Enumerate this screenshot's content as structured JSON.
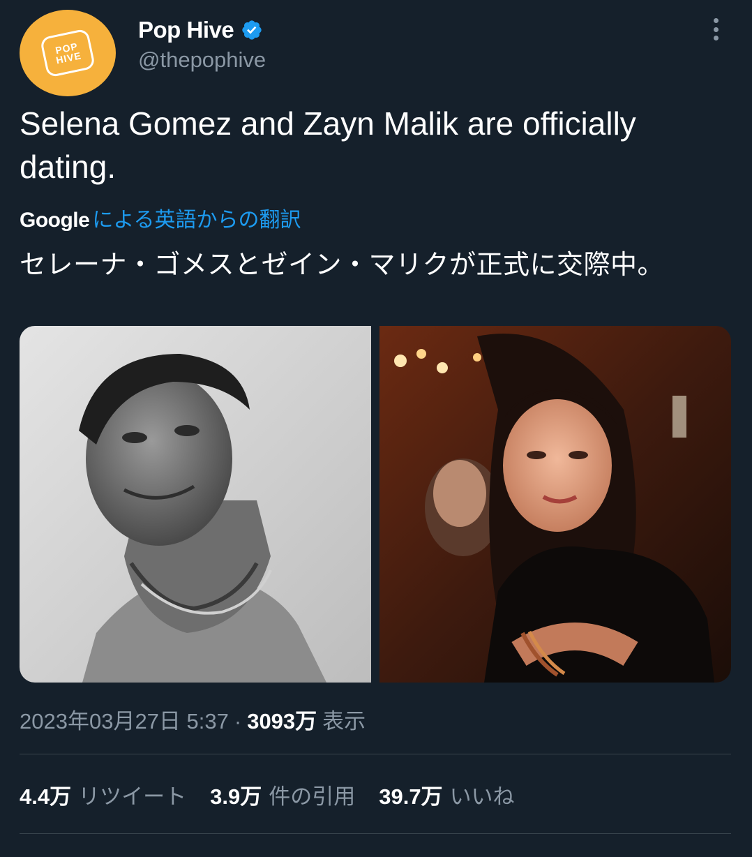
{
  "author": {
    "avatar_text_line1": "POP",
    "avatar_text_line2": "HIVE",
    "display_name": "Pop Hive",
    "handle": "@thepophive",
    "verified": true
  },
  "tweet": {
    "text": "Selena Gomez and Zayn Malik are officially dating.",
    "translation": {
      "provider": "Google",
      "link_text": "による英語からの翻訳",
      "text": "セレーナ・ゴメスとゼイン・マリクが正式に交際中。"
    },
    "media": [
      {
        "name": "photo-zayn",
        "style": "monochrome"
      },
      {
        "name": "photo-selena",
        "style": "color"
      }
    ]
  },
  "meta": {
    "timestamp": "2023年03月27日 5:37",
    "separator": "·",
    "views_count": "3093万",
    "views_label": "表示"
  },
  "stats": [
    {
      "count": "4.4万",
      "label": "リツイート"
    },
    {
      "count": "3.9万",
      "label": "件の引用"
    },
    {
      "count": "39.7万",
      "label": "いいね"
    }
  ],
  "colors": {
    "background": "#15202b",
    "text": "#ffffff",
    "secondary": "#8b98a5",
    "link": "#1d9bf0",
    "avatar": "#f6b13c",
    "verified": "#1d9bf0"
  },
  "icons": [
    "verified-badge-icon",
    "more-options-icon"
  ]
}
